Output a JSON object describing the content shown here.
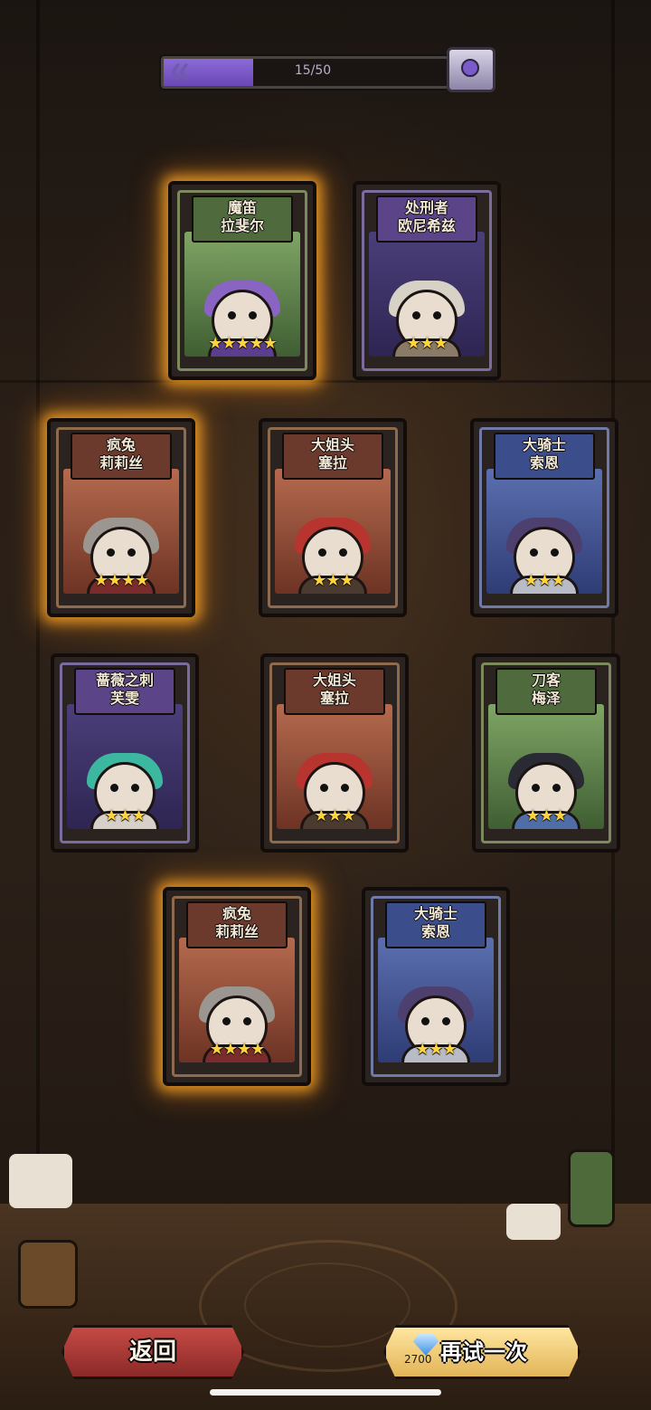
{
  "progress": {
    "text": "15/50",
    "current": 15,
    "total": 50
  },
  "cards": [
    {
      "name_line1": "魔笛",
      "name_line2": "拉斐尔",
      "stars": "★★★★★",
      "theme": "green"
    },
    {
      "name_line1": "处刑者",
      "name_line2": "欧尼希兹",
      "stars": "★★★",
      "theme": "purple"
    },
    {
      "name_line1": "疯兔",
      "name_line2": "莉莉丝",
      "stars": "★★★★",
      "theme": "red"
    },
    {
      "name_line1": "大姐头",
      "name_line2": "塞拉",
      "stars": "★★★",
      "theme": "red"
    },
    {
      "name_line1": "大骑士",
      "name_line2": "索恩",
      "stars": "★★★",
      "theme": "blue"
    },
    {
      "name_line1": "蔷薇之刺",
      "name_line2": "芙雯",
      "stars": "★★★",
      "theme": "purple"
    },
    {
      "name_line1": "大姐头",
      "name_line2": "塞拉",
      "stars": "★★★",
      "theme": "red"
    },
    {
      "name_line1": "刀客",
      "name_line2": "梅泽",
      "stars": "★★★",
      "theme": "green"
    },
    {
      "name_line1": "疯兔",
      "name_line2": "莉莉丝",
      "stars": "★★★★",
      "theme": "red"
    },
    {
      "name_line1": "大骑士",
      "name_line2": "索恩",
      "stars": "★★★",
      "theme": "blue"
    }
  ],
  "buttons": {
    "back_label": "返回",
    "retry_label": "再试一次",
    "retry_cost": "2700"
  },
  "colors": {
    "accent_purple": "#7b5ac9",
    "glow_gold": "#ffaa28",
    "star_yellow": "#ffd43b",
    "back_red": "#c64a45",
    "retry_gold": "#e2b458"
  }
}
